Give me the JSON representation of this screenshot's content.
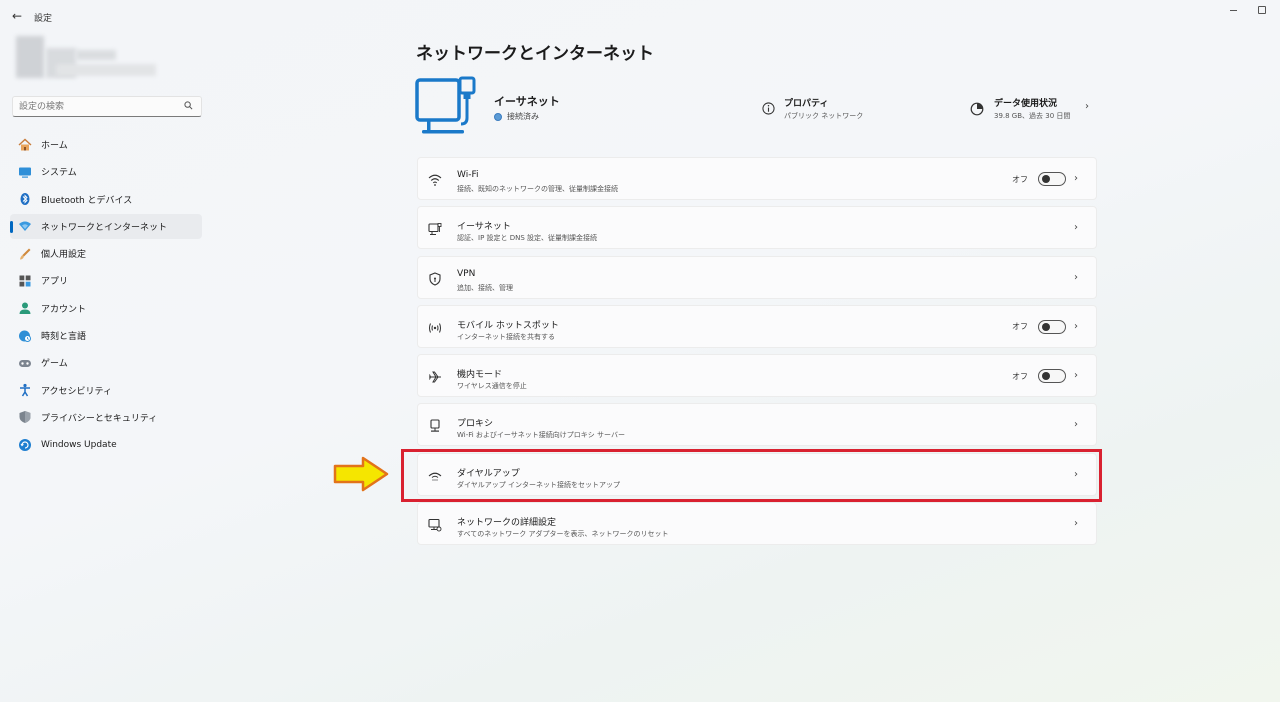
{
  "titlebar": {
    "app_title": "設定"
  },
  "search": {
    "placeholder": "設定の検索"
  },
  "sidebar": {
    "items": [
      {
        "label": "ホーム",
        "icon": "home-icon"
      },
      {
        "label": "システム",
        "icon": "system-icon"
      },
      {
        "label": "Bluetooth とデバイス",
        "icon": "bluetooth-icon"
      },
      {
        "label": "ネットワークとインターネット",
        "icon": "network-icon",
        "selected": true
      },
      {
        "label": "個人用設定",
        "icon": "brush-icon"
      },
      {
        "label": "アプリ",
        "icon": "apps-icon"
      },
      {
        "label": "アカウント",
        "icon": "account-icon"
      },
      {
        "label": "時刻と言語",
        "icon": "time-language-icon"
      },
      {
        "label": "ゲーム",
        "icon": "game-icon"
      },
      {
        "label": "アクセシビリティ",
        "icon": "accessibility-icon"
      },
      {
        "label": "プライバシーとセキュリティ",
        "icon": "shield-icon"
      },
      {
        "label": "Windows Update",
        "icon": "update-icon"
      }
    ]
  },
  "main": {
    "title": "ネットワークとインターネット",
    "connection": {
      "name": "イーサネット",
      "status": "接続済み",
      "properties_title": "プロパティ",
      "properties_sub": "パブリック ネットワーク",
      "data_title": "データ使用状況",
      "data_sub": "39.8 GB、過去 30 日間"
    },
    "cards": [
      {
        "title": "Wi-Fi",
        "desc": "接続、既知のネットワークの管理、従量制課金接続",
        "toggle": "オフ",
        "icon": "wifi-icon"
      },
      {
        "title": "イーサネット",
        "desc": "認証、IP 設定と DNS 設定、従量制課金接続",
        "icon": "ethernet-icon"
      },
      {
        "title": "VPN",
        "desc": "追加、接続、管理",
        "icon": "vpn-shield-icon"
      },
      {
        "title": "モバイル ホットスポット",
        "desc": "インターネット接続を共有する",
        "toggle": "オフ",
        "icon": "hotspot-icon"
      },
      {
        "title": "機内モード",
        "desc": "ワイヤレス通信を停止",
        "toggle": "オフ",
        "icon": "airplane-icon"
      },
      {
        "title": "プロキシ",
        "desc": "Wi-Fi およびイーサネット接続向けプロキシ サーバー",
        "icon": "proxy-icon"
      },
      {
        "title": "ダイヤルアップ",
        "desc": "ダイヤルアップ インターネット接続をセットアップ",
        "icon": "dialup-icon"
      },
      {
        "title": "ネットワークの詳細設定",
        "desc": "すべてのネットワーク アダプターを表示、ネットワークのリセット",
        "icon": "advanced-network-icon"
      }
    ]
  },
  "colors": {
    "accent": "#0067c0",
    "highlight": "#d92130",
    "arrow": "#f5e600"
  }
}
